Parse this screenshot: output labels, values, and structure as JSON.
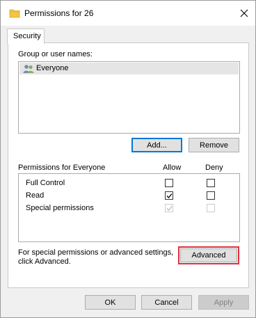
{
  "window": {
    "title": "Permissions for 26"
  },
  "tabs": [
    {
      "label": "Security"
    }
  ],
  "group_section": {
    "label": "Group or user names:",
    "users": [
      {
        "name": "Everyone",
        "icon": "users-icon",
        "selected": true
      }
    ],
    "add_label": "Add...",
    "remove_label": "Remove"
  },
  "permissions": {
    "header_label": "Permissions for Everyone",
    "allow_label": "Allow",
    "deny_label": "Deny",
    "rows": [
      {
        "name": "Full Control",
        "allow": false,
        "deny": false,
        "disabled": false
      },
      {
        "name": "Read",
        "allow": true,
        "deny": false,
        "disabled": false
      },
      {
        "name": "Special permissions",
        "allow": true,
        "deny": false,
        "disabled": true
      }
    ]
  },
  "advanced_section": {
    "text_line1": "For special permissions or advanced settings,",
    "text_line2": "click Advanced.",
    "button_label": "Advanced"
  },
  "footer": {
    "ok_label": "OK",
    "cancel_label": "Cancel",
    "apply_label": "Apply"
  },
  "colors": {
    "focus": "#0078d7",
    "highlight": "#e0303a",
    "selected_row": "#e5e5e5"
  }
}
